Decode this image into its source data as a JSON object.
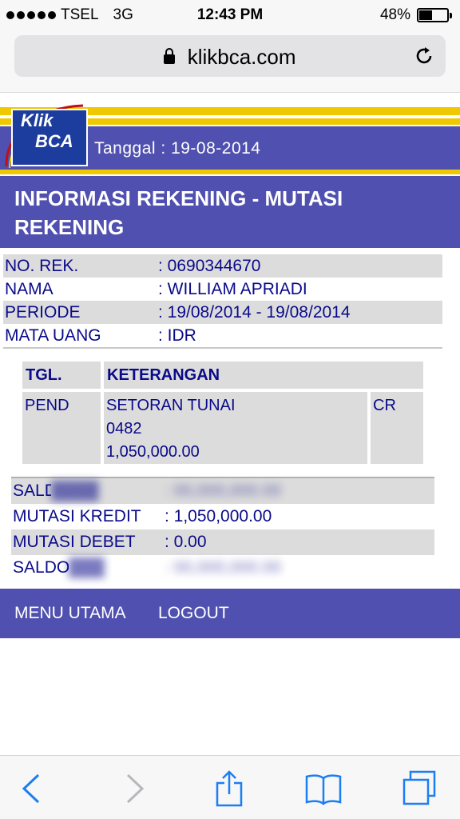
{
  "status_bar": {
    "carrier": "TSEL",
    "network": "3G",
    "time": "12:43 PM",
    "battery_text": "48%",
    "battery_level": 0.48
  },
  "browser": {
    "url": "klikbca.com"
  },
  "bca_header": {
    "logo_line1": "Klik",
    "logo_line2": "BCA",
    "tanggal": "Tanggal : 19-08-2014"
  },
  "title": "INFORMASI REKENING - MUTASI REKENING",
  "account_info": [
    {
      "key": "NO. REK.",
      "value": ": 0690344670"
    },
    {
      "key": "NAMA",
      "value": ": WILLIAM APRIADI"
    },
    {
      "key": "PERIODE",
      "value": ": 19/08/2014 - 19/08/2014"
    },
    {
      "key": "MATA UANG",
      "value": ": IDR"
    }
  ],
  "transactions": {
    "headers": {
      "tgl": "TGL.",
      "keterangan": "KETERANGAN"
    },
    "rows": [
      {
        "tgl": "PEND",
        "ket_line1": "SETORAN TUNAI",
        "ket_line2": "0482",
        "ket_line3": "1,050,000.00",
        "dbcr": "CR"
      }
    ]
  },
  "summary": {
    "saldo_awal_key": "SALDO AWAL",
    "saldo_awal_val": ": 00,000,000.00",
    "mutasi_kredit_key": "MUTASI KREDIT",
    "mutasi_kredit_val": ": 1,050,000.00",
    "mutasi_debet_key": "MUTASI DEBET",
    "mutasi_debet_val": ": 0.00",
    "saldo_akhir_key": "SALDO AKHIR",
    "saldo_akhir_val": ": 00,000,000.00"
  },
  "footer_menu": {
    "menu_utama": "MENU UTAMA",
    "logout": "LOGOUT"
  },
  "colors": {
    "bca_blue": "#5050b0",
    "gold": "#f0c800",
    "text_navy": "#0a0a8a",
    "ios_blue": "#1a7ef5"
  },
  "icons": [
    "lock-icon",
    "reload-icon",
    "back-icon",
    "forward-icon",
    "share-icon",
    "bookmarks-icon",
    "tabs-icon"
  ]
}
